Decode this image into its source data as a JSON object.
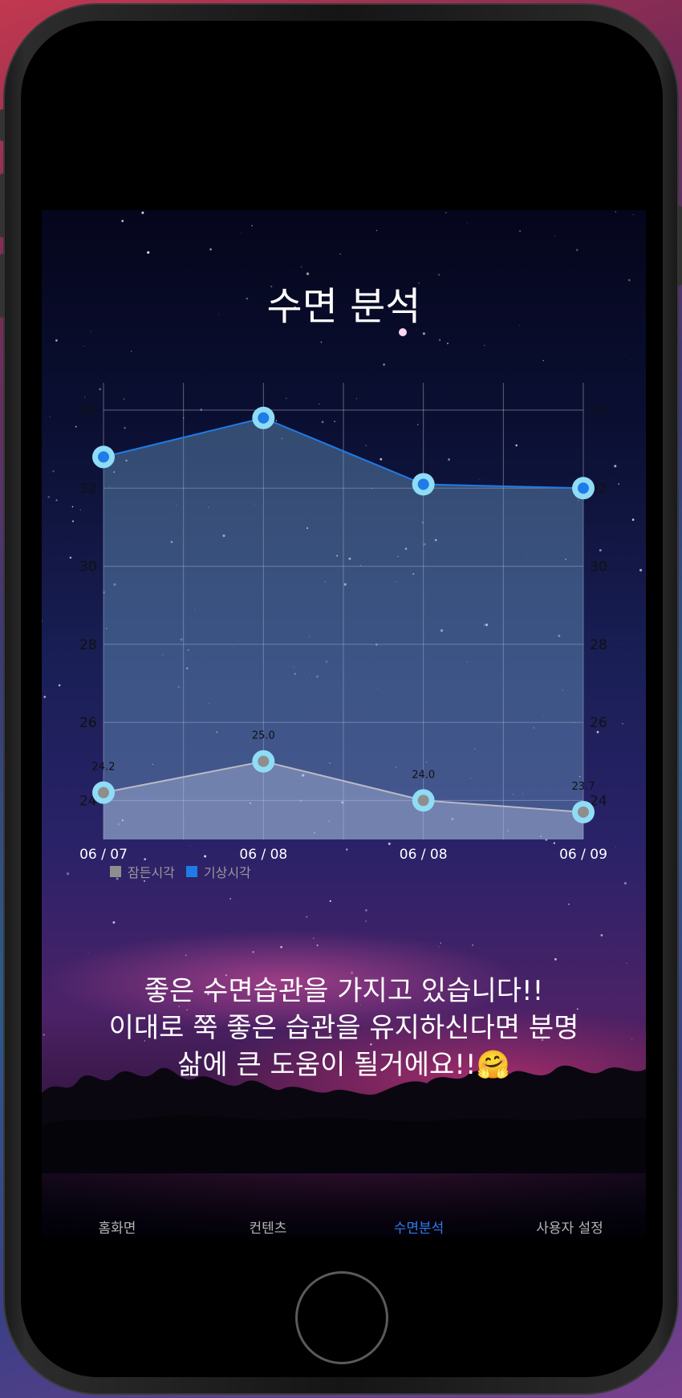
{
  "screen": {
    "title": "수면 분석",
    "message_lines": [
      "좋은 수면습관을 가지고 있습니다!!",
      "이대로 쭉 좋은 습관을 유지하신다면 분명",
      "삶에 큰 도움이 될거에요!!🤗"
    ]
  },
  "tabs": [
    {
      "label": "홈화면",
      "icon": "home-icon",
      "active": false
    },
    {
      "label": "컨텐츠",
      "icon": "content-icon",
      "active": false
    },
    {
      "label": "수면분석",
      "icon": "analysis-icon",
      "active": true
    },
    {
      "label": "사용자 설정",
      "icon": "settings-icon",
      "active": false
    }
  ],
  "colors": {
    "accent": "#2f7bf0",
    "sleep_series": "#8e8e8e",
    "wake_series": "#1f7be6",
    "point_ring": "#8fdcf6"
  },
  "chart_data": {
    "type": "area",
    "categories": [
      "06 / 07",
      "06 / 08",
      "06 / 08",
      "06 / 09"
    ],
    "series": [
      {
        "name": "잠든시각",
        "color": "#8e8e8e",
        "values": [
          24.2,
          25.0,
          24.0,
          23.7
        ],
        "labels": [
          "24.2",
          "25.0",
          "24.0",
          "23.7"
        ]
      },
      {
        "name": "기상시각",
        "color": "#1f7be6",
        "values": [
          32.8,
          33.8,
          32.1,
          32.0
        ],
        "labels": [
          "",
          "",
          "",
          ""
        ]
      }
    ],
    "ylim": [
      23.0,
      34.7
    ],
    "y_ticks": [
      24,
      26,
      28,
      30,
      32,
      34
    ],
    "grid": true,
    "legend": "bottom-left"
  }
}
